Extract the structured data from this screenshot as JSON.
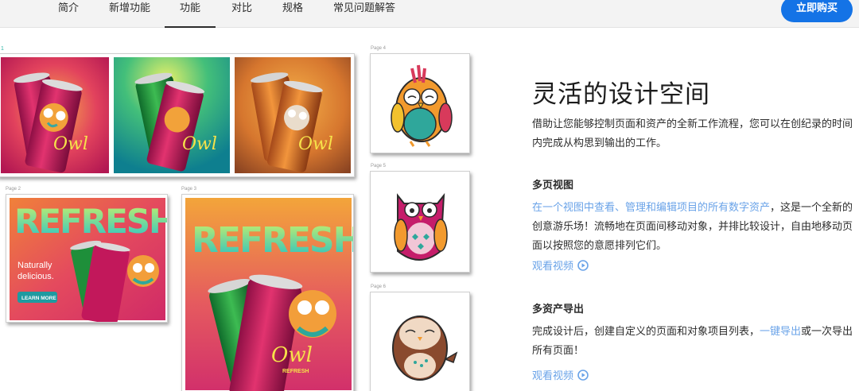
{
  "nav": {
    "tabs": [
      {
        "label": "简介"
      },
      {
        "label": "新增功能"
      },
      {
        "label": "功能"
      },
      {
        "label": "对比"
      },
      {
        "label": "规格"
      },
      {
        "label": "常见问题解答"
      }
    ],
    "active_tab": "功能",
    "buy_button": "立即购买",
    "accent_color": "#1473e6"
  },
  "canvas": {
    "page1_label": "1",
    "page2_label": "Page 2",
    "page3_label": "Page 3",
    "page4_label": "Page 4",
    "page5_label": "Page 5",
    "page6_label": "Page 6",
    "banner_text": "REFRESH",
    "tagline_line1": "Naturally",
    "tagline_line2": "delicious.",
    "learn_more": "LEARN MORE",
    "can_brand": "Owl",
    "can_subtext": "REFRESH"
  },
  "feature": {
    "title": "灵活的设计空间",
    "intro": "借助让您能够控制页面和资产的全新工作流程，您可以在创纪录的时间内完成从构思到输出的工作。",
    "section1": {
      "heading": "多页视图",
      "link_text": "在一个视图中查看、管理和编辑项目的所有数字资产",
      "body": "，这是一个全新的创意游乐场！流畅地在页面间移动对象，并排比较设计，自由地移动页面以按照您的意愿排列它们。",
      "video": "观看视频"
    },
    "section2": {
      "heading": "多资产导出",
      "body_before": "完成设计后，创建自定义的页面和对象项目列表，",
      "link_text": "一键导出",
      "body_after": "或一次导出所有页面！",
      "video": "观看视频"
    }
  }
}
